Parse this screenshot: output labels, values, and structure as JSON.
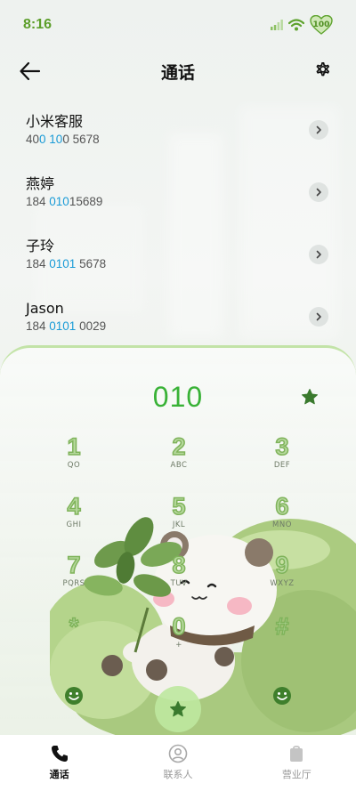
{
  "status_bar": {
    "time": "8:16",
    "battery_level": "100",
    "signal_icon": "signal-icon",
    "wifi_icon": "wifi-icon",
    "battery_icon": "battery-heart-icon"
  },
  "header": {
    "title": "通话",
    "back_icon": "arrow-left-icon",
    "settings_icon": "gear-icon"
  },
  "contacts": [
    {
      "name": "小米客服",
      "number_pre": "40",
      "number_hl": "0 10",
      "number_post": "0 5678"
    },
    {
      "name": "燕婷",
      "number_pre": "184 ",
      "number_hl": "010",
      "number_post": "15689"
    },
    {
      "name": "子玲",
      "number_pre": "184 ",
      "number_hl": "0101",
      "number_post": " 5678"
    },
    {
      "name": "Jason",
      "number_pre": "184 ",
      "number_hl": "0101",
      "number_post": " 0029"
    }
  ],
  "dialpad": {
    "input_value": "010",
    "keys": [
      {
        "num": "1",
        "letters": "QO"
      },
      {
        "num": "2",
        "letters": "ABC"
      },
      {
        "num": "3",
        "letters": "DEF"
      },
      {
        "num": "4",
        "letters": "GHI"
      },
      {
        "num": "5",
        "letters": "JKL"
      },
      {
        "num": "6",
        "letters": "MNO"
      },
      {
        "num": "7",
        "letters": "PQRS"
      },
      {
        "num": "8",
        "letters": "TUV"
      },
      {
        "num": "9",
        "letters": "WXYZ"
      },
      {
        "num": "*",
        "letters": ""
      },
      {
        "num": "0",
        "letters": "+"
      },
      {
        "num": "#",
        "letters": ""
      }
    ]
  },
  "tabs": [
    {
      "label": "通话",
      "icon": "phone-icon",
      "active": true
    },
    {
      "label": "联系人",
      "icon": "contacts-icon",
      "active": false
    },
    {
      "label": "营业厅",
      "icon": "shopping-bag-icon",
      "active": false
    }
  ],
  "colors": {
    "accent_green": "#39b237",
    "status_green": "#5c9e2a",
    "highlight_blue": "#1a9bd7"
  }
}
